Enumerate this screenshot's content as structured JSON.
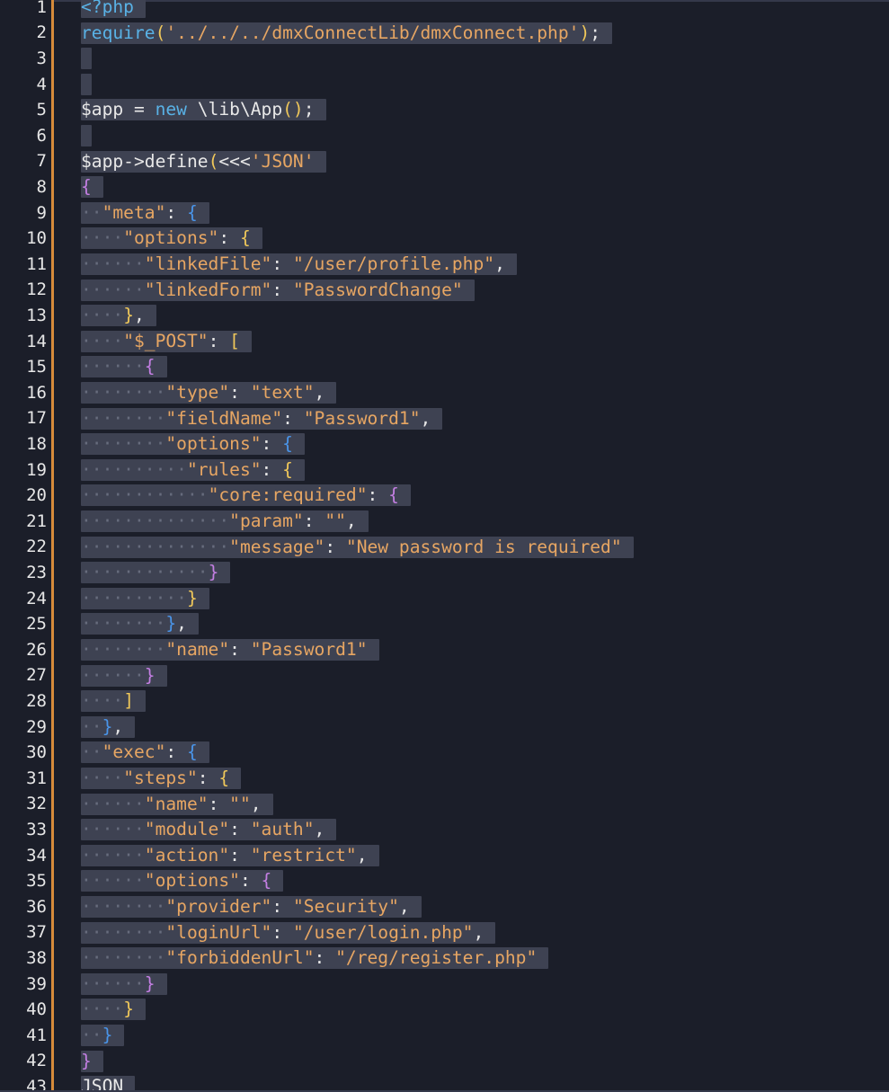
{
  "editor": {
    "language": "php",
    "colors": {
      "background": "#1b1e29",
      "selection": "#3e4252",
      "modified_indicator": "#d68b3a",
      "line_number": "#e6e6e6",
      "whitespace_dot": "#676c7d",
      "keyword": "#59b2e6",
      "string": "#e7a663",
      "brace_level_1": "#f0c85a",
      "brace_level_2": "#c47fe3",
      "brace_level_3": "#4a95ea",
      "plain": "#e8e8e8"
    },
    "lines": [
      {
        "num": "1",
        "tokens": [
          {
            "t": "<?php",
            "c": "k"
          }
        ]
      },
      {
        "num": "2",
        "tokens": [
          {
            "t": "require",
            "c": "k"
          },
          {
            "t": "(",
            "c": "y"
          },
          {
            "t": "'../../../dmxConnectLib/dmxConnect.php'",
            "c": "s"
          },
          {
            "t": ")",
            "c": "y"
          },
          {
            "t": ";",
            "c": "w"
          }
        ]
      },
      {
        "num": "3",
        "tokens": []
      },
      {
        "num": "4",
        "tokens": []
      },
      {
        "num": "5",
        "tokens": [
          {
            "t": "$app",
            "c": "w"
          },
          {
            "t": " = ",
            "c": "w"
          },
          {
            "t": "new",
            "c": "k"
          },
          {
            "t": " \\lib\\App",
            "c": "w"
          },
          {
            "t": "()",
            "c": "y"
          },
          {
            "t": ";",
            "c": "w"
          }
        ]
      },
      {
        "num": "6",
        "tokens": []
      },
      {
        "num": "7",
        "tokens": [
          {
            "t": "$app->define",
            "c": "w"
          },
          {
            "t": "(",
            "c": "y"
          },
          {
            "t": "<<<",
            "c": "w"
          },
          {
            "t": "'JSON'",
            "c": "s"
          }
        ]
      },
      {
        "num": "8",
        "tokens": [
          {
            "t": "{",
            "c": "m"
          }
        ]
      },
      {
        "num": "9",
        "tokens": [
          {
            "t": "··",
            "c": "ws"
          },
          {
            "t": "\"meta\"",
            "c": "s"
          },
          {
            "t": ": ",
            "c": "w"
          },
          {
            "t": "{",
            "c": "b"
          }
        ]
      },
      {
        "num": "10",
        "tokens": [
          {
            "t": "····",
            "c": "ws"
          },
          {
            "t": "\"options\"",
            "c": "s"
          },
          {
            "t": ": ",
            "c": "w"
          },
          {
            "t": "{",
            "c": "y"
          }
        ]
      },
      {
        "num": "11",
        "tokens": [
          {
            "t": "······",
            "c": "ws"
          },
          {
            "t": "\"linkedFile\"",
            "c": "s"
          },
          {
            "t": ": ",
            "c": "w"
          },
          {
            "t": "\"/user/profile.php\"",
            "c": "s"
          },
          {
            "t": ",",
            "c": "w"
          }
        ]
      },
      {
        "num": "12",
        "tokens": [
          {
            "t": "······",
            "c": "ws"
          },
          {
            "t": "\"linkedForm\"",
            "c": "s"
          },
          {
            "t": ": ",
            "c": "w"
          },
          {
            "t": "\"PasswordChange\"",
            "c": "s"
          }
        ]
      },
      {
        "num": "13",
        "tokens": [
          {
            "t": "····",
            "c": "ws"
          },
          {
            "t": "}",
            "c": "y"
          },
          {
            "t": ",",
            "c": "w"
          }
        ]
      },
      {
        "num": "14",
        "tokens": [
          {
            "t": "····",
            "c": "ws"
          },
          {
            "t": "\"$_POST\"",
            "c": "s"
          },
          {
            "t": ": ",
            "c": "w"
          },
          {
            "t": "[",
            "c": "y"
          }
        ]
      },
      {
        "num": "15",
        "tokens": [
          {
            "t": "······",
            "c": "ws"
          },
          {
            "t": "{",
            "c": "m"
          }
        ]
      },
      {
        "num": "16",
        "tokens": [
          {
            "t": "········",
            "c": "ws"
          },
          {
            "t": "\"type\"",
            "c": "s"
          },
          {
            "t": ": ",
            "c": "w"
          },
          {
            "t": "\"text\"",
            "c": "s"
          },
          {
            "t": ",",
            "c": "w"
          }
        ]
      },
      {
        "num": "17",
        "tokens": [
          {
            "t": "········",
            "c": "ws"
          },
          {
            "t": "\"fieldName\"",
            "c": "s"
          },
          {
            "t": ": ",
            "c": "w"
          },
          {
            "t": "\"Password1\"",
            "c": "s"
          },
          {
            "t": ",",
            "c": "w"
          }
        ]
      },
      {
        "num": "18",
        "tokens": [
          {
            "t": "········",
            "c": "ws"
          },
          {
            "t": "\"options\"",
            "c": "s"
          },
          {
            "t": ": ",
            "c": "w"
          },
          {
            "t": "{",
            "c": "b"
          }
        ]
      },
      {
        "num": "19",
        "tokens": [
          {
            "t": "··········",
            "c": "ws"
          },
          {
            "t": "\"rules\"",
            "c": "s"
          },
          {
            "t": ": ",
            "c": "w"
          },
          {
            "t": "{",
            "c": "y"
          }
        ]
      },
      {
        "num": "20",
        "tokens": [
          {
            "t": "············",
            "c": "ws"
          },
          {
            "t": "\"core:required\"",
            "c": "s"
          },
          {
            "t": ": ",
            "c": "w"
          },
          {
            "t": "{",
            "c": "m"
          }
        ]
      },
      {
        "num": "21",
        "tokens": [
          {
            "t": "··············",
            "c": "ws"
          },
          {
            "t": "\"param\"",
            "c": "s"
          },
          {
            "t": ": ",
            "c": "w"
          },
          {
            "t": "\"\"",
            "c": "s"
          },
          {
            "t": ",",
            "c": "w"
          }
        ]
      },
      {
        "num": "22",
        "tokens": [
          {
            "t": "··············",
            "c": "ws"
          },
          {
            "t": "\"message\"",
            "c": "s"
          },
          {
            "t": ": ",
            "c": "w"
          },
          {
            "t": "\"New password is required\"",
            "c": "s"
          }
        ]
      },
      {
        "num": "23",
        "tokens": [
          {
            "t": "············",
            "c": "ws"
          },
          {
            "t": "}",
            "c": "m"
          }
        ]
      },
      {
        "num": "24",
        "tokens": [
          {
            "t": "··········",
            "c": "ws"
          },
          {
            "t": "}",
            "c": "y"
          }
        ]
      },
      {
        "num": "25",
        "tokens": [
          {
            "t": "········",
            "c": "ws"
          },
          {
            "t": "}",
            "c": "b"
          },
          {
            "t": ",",
            "c": "w"
          }
        ]
      },
      {
        "num": "26",
        "tokens": [
          {
            "t": "········",
            "c": "ws"
          },
          {
            "t": "\"name\"",
            "c": "s"
          },
          {
            "t": ": ",
            "c": "w"
          },
          {
            "t": "\"Password1\"",
            "c": "s"
          }
        ]
      },
      {
        "num": "27",
        "tokens": [
          {
            "t": "······",
            "c": "ws"
          },
          {
            "t": "}",
            "c": "m"
          }
        ]
      },
      {
        "num": "28",
        "tokens": [
          {
            "t": "····",
            "c": "ws"
          },
          {
            "t": "]",
            "c": "y"
          }
        ]
      },
      {
        "num": "29",
        "tokens": [
          {
            "t": "··",
            "c": "ws"
          },
          {
            "t": "}",
            "c": "b"
          },
          {
            "t": ",",
            "c": "w"
          }
        ]
      },
      {
        "num": "30",
        "tokens": [
          {
            "t": "··",
            "c": "ws"
          },
          {
            "t": "\"exec\"",
            "c": "s"
          },
          {
            "t": ": ",
            "c": "w"
          },
          {
            "t": "{",
            "c": "b"
          }
        ]
      },
      {
        "num": "31",
        "tokens": [
          {
            "t": "····",
            "c": "ws"
          },
          {
            "t": "\"steps\"",
            "c": "s"
          },
          {
            "t": ": ",
            "c": "w"
          },
          {
            "t": "{",
            "c": "y"
          }
        ]
      },
      {
        "num": "32",
        "tokens": [
          {
            "t": "······",
            "c": "ws"
          },
          {
            "t": "\"name\"",
            "c": "s"
          },
          {
            "t": ": ",
            "c": "w"
          },
          {
            "t": "\"\"",
            "c": "s"
          },
          {
            "t": ",",
            "c": "w"
          }
        ]
      },
      {
        "num": "33",
        "tokens": [
          {
            "t": "······",
            "c": "ws"
          },
          {
            "t": "\"module\"",
            "c": "s"
          },
          {
            "t": ": ",
            "c": "w"
          },
          {
            "t": "\"auth\"",
            "c": "s"
          },
          {
            "t": ",",
            "c": "w"
          }
        ]
      },
      {
        "num": "34",
        "tokens": [
          {
            "t": "······",
            "c": "ws"
          },
          {
            "t": "\"action\"",
            "c": "s"
          },
          {
            "t": ": ",
            "c": "w"
          },
          {
            "t": "\"restrict\"",
            "c": "s"
          },
          {
            "t": ",",
            "c": "w"
          }
        ]
      },
      {
        "num": "35",
        "tokens": [
          {
            "t": "······",
            "c": "ws"
          },
          {
            "t": "\"options\"",
            "c": "s"
          },
          {
            "t": ": ",
            "c": "w"
          },
          {
            "t": "{",
            "c": "m"
          }
        ]
      },
      {
        "num": "36",
        "tokens": [
          {
            "t": "········",
            "c": "ws"
          },
          {
            "t": "\"provider\"",
            "c": "s"
          },
          {
            "t": ": ",
            "c": "w"
          },
          {
            "t": "\"Security\"",
            "c": "s"
          },
          {
            "t": ",",
            "c": "w"
          }
        ]
      },
      {
        "num": "37",
        "tokens": [
          {
            "t": "········",
            "c": "ws"
          },
          {
            "t": "\"loginUrl\"",
            "c": "s"
          },
          {
            "t": ": ",
            "c": "w"
          },
          {
            "t": "\"/user/login.php\"",
            "c": "s"
          },
          {
            "t": ",",
            "c": "w"
          }
        ]
      },
      {
        "num": "38",
        "tokens": [
          {
            "t": "········",
            "c": "ws"
          },
          {
            "t": "\"forbiddenUrl\"",
            "c": "s"
          },
          {
            "t": ": ",
            "c": "w"
          },
          {
            "t": "\"/reg/register.php\"",
            "c": "s"
          }
        ]
      },
      {
        "num": "39",
        "tokens": [
          {
            "t": "······",
            "c": "ws"
          },
          {
            "t": "}",
            "c": "m"
          }
        ]
      },
      {
        "num": "40",
        "tokens": [
          {
            "t": "····",
            "c": "ws"
          },
          {
            "t": "}",
            "c": "y"
          }
        ]
      },
      {
        "num": "41",
        "tokens": [
          {
            "t": "··",
            "c": "ws"
          },
          {
            "t": "}",
            "c": "b"
          }
        ]
      },
      {
        "num": "42",
        "tokens": [
          {
            "t": "}",
            "c": "m"
          }
        ]
      },
      {
        "num": "43",
        "tokens": [
          {
            "t": "JSON",
            "c": "w"
          }
        ]
      }
    ]
  }
}
